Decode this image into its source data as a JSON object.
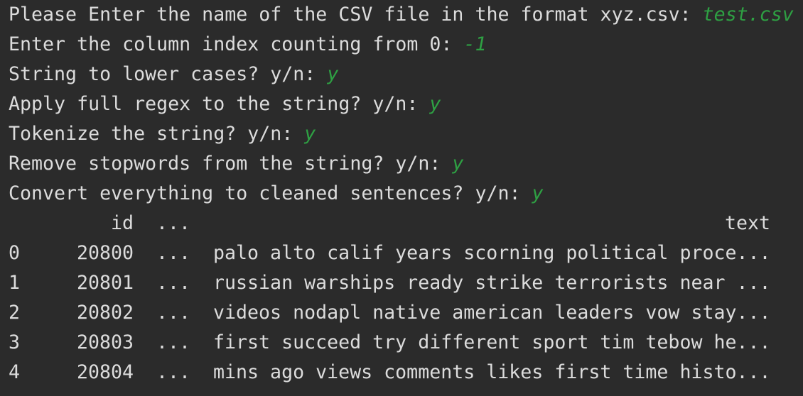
{
  "prompts": [
    {
      "question": "Please Enter the name of the CSV file in the format xyz.csv: ",
      "answer": "test.csv"
    },
    {
      "question": "Enter the column index counting from 0: ",
      "answer": "-1"
    },
    {
      "question": "String to lower cases? y/n: ",
      "answer": "y"
    },
    {
      "question": "Apply full regex to the string? y/n: ",
      "answer": "y"
    },
    {
      "question": "Tokenize the string? y/n: ",
      "answer": "y"
    },
    {
      "question": "Remove stopwords from the string? y/n: ",
      "answer": "y"
    },
    {
      "question": "Convert everything to cleaned sentences? y/n: ",
      "answer": "y"
    }
  ],
  "table": {
    "headers": {
      "id": "id",
      "ellipsis": "...",
      "text": "text"
    },
    "rows": [
      {
        "index": "0",
        "id": "20800",
        "ellipsis": "...",
        "text": "palo alto calif years scorning political proce..."
      },
      {
        "index": "1",
        "id": "20801",
        "ellipsis": "...",
        "text": "russian warships ready strike terrorists near ..."
      },
      {
        "index": "2",
        "id": "20802",
        "ellipsis": "...",
        "text": "videos nodapl native american leaders vow stay..."
      },
      {
        "index": "3",
        "id": "20803",
        "ellipsis": "...",
        "text": "first succeed try different sport tim tebow he..."
      },
      {
        "index": "4",
        "id": "20804",
        "ellipsis": "...",
        "text": "mins ago views comments likes first time histo..."
      }
    ]
  },
  "colors": {
    "background": "#2b2b2b",
    "output_text": "#dcdcdc",
    "user_input": "#2ea043"
  }
}
